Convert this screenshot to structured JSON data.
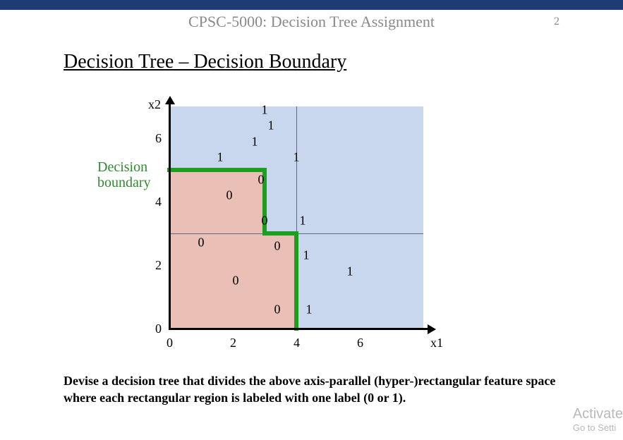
{
  "header": {
    "title": "CPSC-5000: Decision Tree Assignment",
    "page_number": "2"
  },
  "section_title": "Decision Tree – Decision Boundary",
  "legend": {
    "label_line1": "Decision",
    "label_line2": "boundary"
  },
  "axes": {
    "x_name": "x1",
    "y_name": "x2",
    "x_ticks": [
      "0",
      "2",
      "4",
      "6"
    ],
    "y_ticks": [
      "0",
      "2",
      "4",
      "6"
    ]
  },
  "prompt_text": "Devise a decision tree that divides the above axis-parallel (hyper-)rectangular feature space where each rectangular region is labeled with one label (0 or 1).",
  "watermark": {
    "line1": "Activate",
    "line2": "Go to Setti"
  },
  "chart_data": {
    "type": "scatter",
    "title": "",
    "xlabel": "x1",
    "ylabel": "x2",
    "xlim": [
      0,
      8
    ],
    "ylim": [
      0,
      7
    ],
    "grid": true,
    "series": [
      {
        "name": "class-0",
        "label": "0",
        "points": [
          {
            "x": 1.0,
            "y": 2.7
          },
          {
            "x": 1.9,
            "y": 4.2
          },
          {
            "x": 2.1,
            "y": 1.5
          },
          {
            "x": 2.9,
            "y": 4.7
          },
          {
            "x": 3.0,
            "y": 3.4
          },
          {
            "x": 3.4,
            "y": 2.6
          },
          {
            "x": 3.4,
            "y": 0.6
          }
        ]
      },
      {
        "name": "class-1",
        "label": "1",
        "points": [
          {
            "x": 1.6,
            "y": 5.4
          },
          {
            "x": 2.7,
            "y": 5.9
          },
          {
            "x": 3.0,
            "y": 6.9
          },
          {
            "x": 3.2,
            "y": 6.4
          },
          {
            "x": 4.0,
            "y": 5.4
          },
          {
            "x": 4.2,
            "y": 3.4
          },
          {
            "x": 4.3,
            "y": 2.3
          },
          {
            "x": 4.4,
            "y": 0.6
          },
          {
            "x": 5.7,
            "y": 1.8
          }
        ]
      }
    ],
    "decision_boundary": [
      {
        "x": 0,
        "y": 5
      },
      {
        "x": 3,
        "y": 5
      },
      {
        "x": 3,
        "y": 3
      },
      {
        "x": 4,
        "y": 3
      },
      {
        "x": 4,
        "y": 0
      }
    ],
    "regions": [
      {
        "label": "0",
        "x_range": [
          0,
          3
        ],
        "y_range": [
          3,
          5
        ]
      },
      {
        "label": "0",
        "x_range": [
          0,
          4
        ],
        "y_range": [
          0,
          3
        ]
      },
      {
        "label": "1",
        "complement": true
      }
    ],
    "gridlines": {
      "x": [
        4
      ],
      "y": [
        3
      ]
    }
  }
}
